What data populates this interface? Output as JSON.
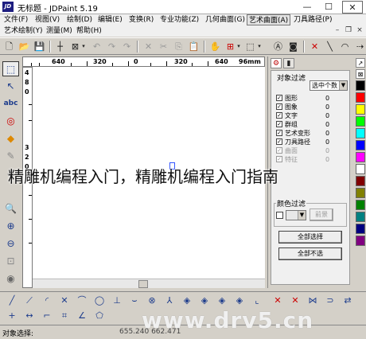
{
  "window": {
    "title": "无标题 - JDPaint 5.19",
    "app_icon_text": "JD"
  },
  "menu": {
    "row1": [
      "文件(F)",
      "视图(V)",
      "绘制(D)",
      "编辑(E)",
      "变换(R)",
      "专业功能(Z)",
      "几何曲面(G)",
      "艺术曲面(A)",
      "刀具路径(P)"
    ],
    "row2": [
      "艺术绘制(Y)",
      "测量(M)",
      "帮助(H)"
    ]
  },
  "ruler": {
    "h_labels": [
      "640",
      "320",
      "0",
      "320",
      "640",
      "96mm"
    ],
    "v_labels": [
      "4",
      "8",
      "0",
      "3",
      "2",
      "0"
    ]
  },
  "panel": {
    "group_title": "对象过滤",
    "select_mode": "选中个数",
    "filters": [
      {
        "label": "图形",
        "count": "0",
        "checked": true,
        "enabled": true
      },
      {
        "label": "图象",
        "count": "0",
        "checked": true,
        "enabled": true
      },
      {
        "label": "文字",
        "count": "0",
        "checked": true,
        "enabled": true
      },
      {
        "label": "群组",
        "count": "0",
        "checked": true,
        "enabled": true
      },
      {
        "label": "艺术变形",
        "count": "0",
        "checked": true,
        "enabled": true
      },
      {
        "label": "刀具路径",
        "count": "0",
        "checked": true,
        "enabled": true
      },
      {
        "label": "曲面",
        "count": "0",
        "checked": true,
        "enabled": false
      },
      {
        "label": "特征",
        "count": "0",
        "checked": true,
        "enabled": false
      }
    ],
    "color_group_title": "颜色过滤",
    "color_button": "前景",
    "select_all": "全部选择",
    "select_none": "全部不选"
  },
  "palette": {
    "colors": [
      "#000000",
      "#ff0000",
      "#ffff00",
      "#00ff00",
      "#00ffff",
      "#0000ff",
      "#ff00ff",
      "#ffffff",
      "#800000",
      "#808000",
      "#008000",
      "#008080",
      "#000080",
      "#800080"
    ]
  },
  "status": {
    "label": "对象选择:",
    "coords": "655.240  662.471"
  },
  "overlay": {
    "caption": "精雕机编程入门，精雕机编程入门指南",
    "watermark": "www.drv5.cn"
  }
}
